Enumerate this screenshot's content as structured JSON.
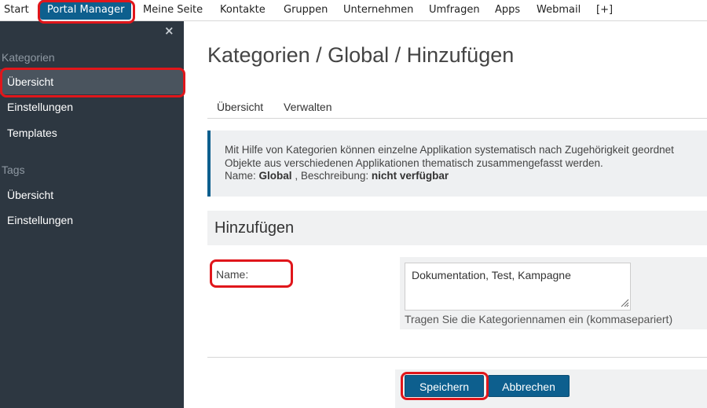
{
  "topnav": {
    "items": [
      "Start",
      "Portal Manager",
      "Meine Seite",
      "Kontakte",
      "Gruppen",
      "Unternehmen",
      "Umfragen",
      "Apps",
      "Webmail",
      "[+]"
    ],
    "active": "Portal Manager"
  },
  "sidebar": {
    "close_glyph": "×",
    "sections": [
      {
        "title": "Kategorien",
        "items": [
          "Übersicht",
          "Einstellungen",
          "Templates"
        ]
      },
      {
        "title": "Tags",
        "items": [
          "Übersicht",
          "Einstellungen"
        ]
      }
    ]
  },
  "page": {
    "title": "Kategorien / Global / Hinzufügen",
    "tabs": [
      "Übersicht",
      "Verwalten"
    ]
  },
  "info": {
    "line1": "Mit Hilfe von Kategorien können einzelne Applikation systematisch nach Zugehörigkeit geordnet",
    "line2": "Objekte aus verschiedenen Applikationen thematisch zusammengefasst werden.",
    "name_label": "Name:",
    "name_value": "Global",
    "desc_label": ", Beschreibung:",
    "desc_value": "nicht verfügbar"
  },
  "form": {
    "heading": "Hinzufügen",
    "name_label": "Name:",
    "name_value": "Dokumentation, Test, Kampagne",
    "help": "Tragen Sie die Kategoriennamen ein (kommasepariert)"
  },
  "buttons": {
    "save": "Speichern",
    "cancel": "Abbrechen"
  },
  "colors": {
    "accent": "#0d5f8e",
    "sidebar_bg": "#2d3741",
    "highlight": "#e0161b"
  }
}
